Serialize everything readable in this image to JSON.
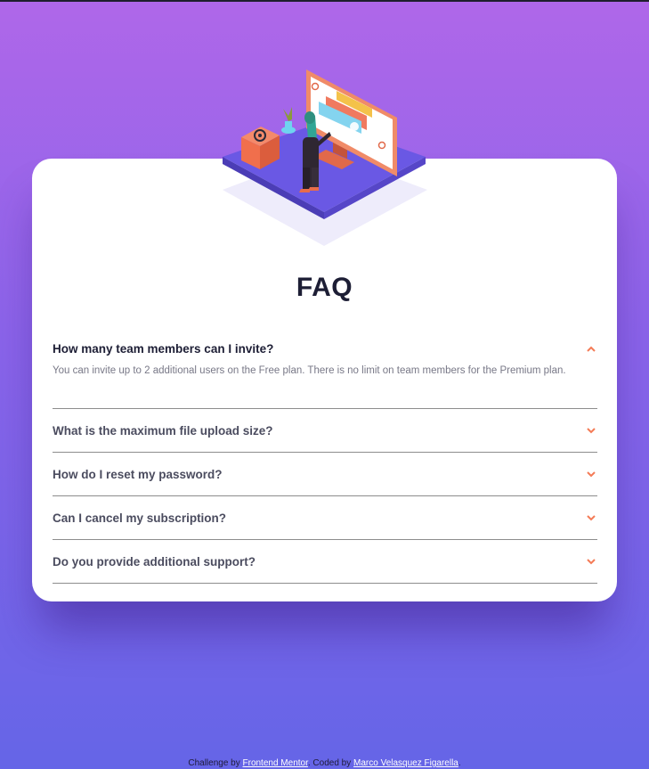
{
  "page": {
    "title": "FAQ"
  },
  "colors": {
    "accent": "#f47b56",
    "text_dark": "#1d1e35",
    "text_muted": "#787887",
    "bg_top": "#af67e9",
    "bg_bottom": "#6565e7"
  },
  "faq": [
    {
      "question": "How many team members can I invite?",
      "answer": "You can invite up to 2 additional users on the Free plan. There is no limit on team members for the Premium plan.",
      "expanded": true,
      "icon": "chevron-up-icon"
    },
    {
      "question": "What is the maximum file upload size?",
      "answer": "",
      "expanded": false,
      "icon": "chevron-down-icon"
    },
    {
      "question": "How do I reset my password?",
      "answer": "",
      "expanded": false,
      "icon": "chevron-down-icon"
    },
    {
      "question": "Can I cancel my subscription?",
      "answer": "",
      "expanded": false,
      "icon": "chevron-down-icon"
    },
    {
      "question": "Do you provide additional support?",
      "answer": "",
      "expanded": false,
      "icon": "chevron-down-icon"
    }
  ],
  "footer": {
    "challenge_prefix": "Challenge by ",
    "challenge_link": "Frontend Mentor",
    "coded_prefix": ". Coded by ",
    "coded_link": "Marco Velasquez Figarella",
    "suffix": "."
  }
}
